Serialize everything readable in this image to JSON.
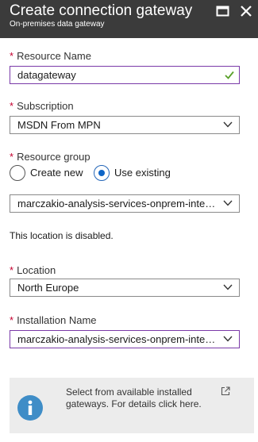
{
  "header": {
    "title": "Create connection gateway",
    "subtitle": "On-premises data gateway"
  },
  "required_marker": "*",
  "resource_name": {
    "label": "Resource Name",
    "value": "datagateway"
  },
  "subscription": {
    "label": "Subscription",
    "value": "MSDN From MPN"
  },
  "resource_group": {
    "label": "Resource group",
    "options": [
      "Create new",
      "Use existing"
    ],
    "selected": "Use existing",
    "value": "marczakio-analysis-services-onprem-integ..."
  },
  "location_note": "This location is disabled.",
  "location": {
    "label": "Location",
    "value": "North Europe"
  },
  "installation_name": {
    "label": "Installation Name",
    "value": "marczakio-analysis-services-onprem-integ..."
  },
  "info": {
    "text": "Select from available installed gateways. For details click here."
  },
  "colors": {
    "header_bg": "#3b3b3b",
    "required": "#c4002f",
    "valid_check": "#5aa12b",
    "radio_selected": "#0e65c7",
    "info_icon": "#3f8dc7",
    "info_bg": "#ececec"
  },
  "icons": {
    "maximize": "maximize-icon",
    "close": "close-icon",
    "chevron": "chevron-down-icon",
    "check": "checkmark-icon",
    "info": "info-icon",
    "external": "external-link-icon"
  }
}
